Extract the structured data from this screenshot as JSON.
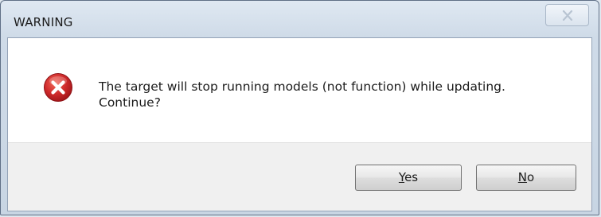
{
  "window": {
    "title": "WARNING",
    "close_icon": "close-icon"
  },
  "message": {
    "icon": "error-icon",
    "line1": "The target will stop running models (not function) while updating.",
    "line2": "Continue?"
  },
  "buttons": {
    "yes": {
      "accel": "Y",
      "rest": "es"
    },
    "no": {
      "accel": "N",
      "rest": "o"
    }
  },
  "colors": {
    "error_red": "#c8262a",
    "title_bar": "#cfdbe8",
    "button_bar": "#f0f0f0"
  }
}
